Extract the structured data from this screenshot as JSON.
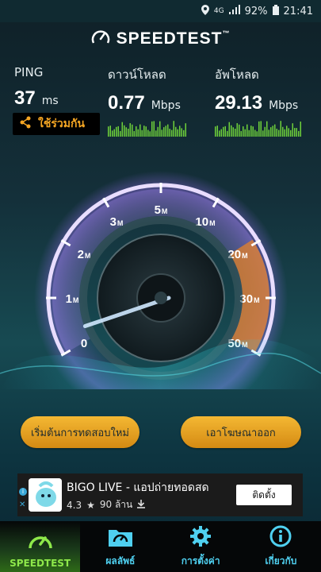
{
  "status_bar": {
    "network": "4G",
    "battery": "92%",
    "time": "21:41"
  },
  "header": {
    "title": "SPEEDTEST",
    "trademark": "™"
  },
  "metrics": {
    "ping": {
      "label": "PING",
      "value": "37",
      "unit": "ms"
    },
    "download": {
      "label": "ดาวน์โหลด",
      "value": "0.77",
      "unit": "Mbps"
    },
    "upload": {
      "label": "อัพโหลด",
      "value": "29.13",
      "unit": "Mbps"
    }
  },
  "share": {
    "label": "ใช้ร่วมกัน"
  },
  "gauge": {
    "ticks": [
      "0",
      "1M",
      "2M",
      "3M",
      "5M",
      "10M",
      "20M",
      "30M",
      "50M"
    ],
    "needle_tick_position": 0.04
  },
  "buttons": {
    "restart": "เริ่มต้นการทดสอบใหม่",
    "remove_ads": "เอาโฆษณาออก"
  },
  "ad": {
    "title": "BIGO LIVE - แอปถ่ายทอดสด",
    "rating": "4.3",
    "installs": "90 ล้าน",
    "install_label": "ติดตั้ง",
    "info_glyph": "i",
    "close_glyph": "✕"
  },
  "nav": [
    {
      "label": "SPEEDTEST",
      "icon": "speedometer-icon",
      "active": true
    },
    {
      "label": "ผลลัพธ์",
      "icon": "results-folder-icon",
      "active": false
    },
    {
      "label": "การตั้งค่า",
      "icon": "gear-icon",
      "active": false
    },
    {
      "label": "เกี่ยวกับ",
      "icon": "info-icon",
      "active": false
    }
  ],
  "colors": {
    "accent_orange": "#f5a623",
    "accent_cyan": "#4fd0f0",
    "accent_green": "#8ee84a",
    "gauge_glow": "#b38cff"
  }
}
